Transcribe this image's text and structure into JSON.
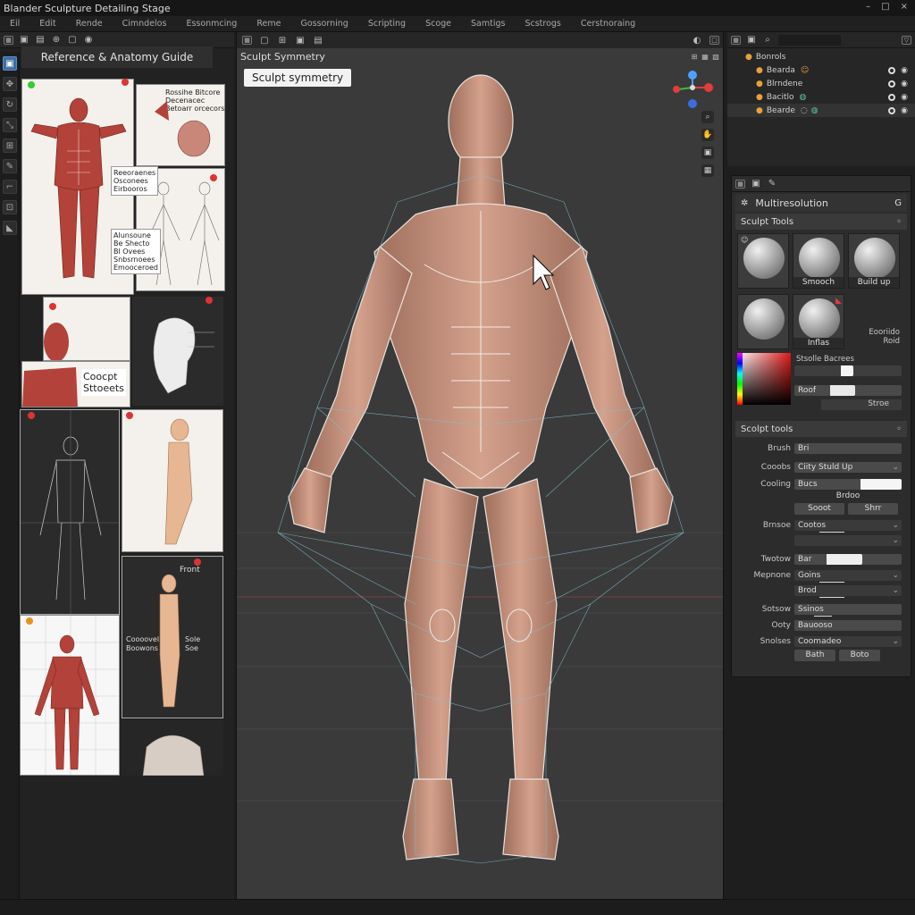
{
  "title": "Blander Sculpture Detailing Stage",
  "window_controls": [
    "–",
    "□",
    "×"
  ],
  "menu": [
    "Eil",
    "Edit",
    "Rende",
    "Cimndelos",
    "Essonmcing",
    "Reme",
    "Gossorning",
    "Scripting",
    "Scoge",
    "Samtigs",
    "Scstrogs",
    "Cerstnoraing"
  ],
  "left_panel": {
    "header": "Reference & Anatomy Guide",
    "notes": {
      "top_right": "Rossihe Bitcore\nDecenacec\nBetoarr orcecors",
      "mid_note": "Reeoraenes\nOsconees\nEirbooros",
      "left_note": "Alunsoune\nBe Shecto\nBl Ovees\nSnbsrnoees\nEmooceroed",
      "concept": "Coocpt\nSttoeets",
      "front": "Front",
      "side_labels": [
        "Coooovel",
        "Sole",
        "Boowons",
        "Soe"
      ]
    },
    "tools": [
      "cube",
      "move",
      "rotate",
      "scale",
      "transform",
      "annotate",
      "measure",
      "add",
      "ruler"
    ]
  },
  "viewport": {
    "header_icons": [
      "view-icon",
      "select-icon",
      "add-icon",
      "object-icon",
      "overlay-icon",
      "shading-icon"
    ],
    "subtitle": "Sculpt Symmetry",
    "badge": "Sculpt symmetry",
    "nav": [
      "zoom",
      "pan",
      "camera",
      "persp"
    ]
  },
  "outliner": {
    "rows": [
      {
        "label": "Bonrols",
        "indent": 0
      },
      {
        "label": "Bearda",
        "indent": 1
      },
      {
        "label": "Blrndene",
        "indent": 1
      },
      {
        "label": "Bacitlo",
        "indent": 1
      },
      {
        "label": "Bearde",
        "indent": 1
      }
    ]
  },
  "properties": {
    "modifier": "Multiresolution",
    "sculpt_tools_header": "Sculpt Tools",
    "tiles": [
      {
        "label": ""
      },
      {
        "label": "Smooch"
      },
      {
        "label": "Build up"
      },
      {
        "label": ""
      },
      {
        "label": "Inflas"
      }
    ],
    "side_text": "Eooriido\nRoid",
    "stroke_header": "Stsolle Bacrees",
    "color_rows": [
      "Roof",
      "Stroe"
    ],
    "sculpt_header": "Scolpt tools",
    "fields": [
      {
        "label": "Brush",
        "value": "Bri"
      },
      {
        "label": "Cooobs",
        "value": "Ciity Stuld Up"
      },
      {
        "label": "Cooling",
        "value": "Bucs"
      },
      {
        "label": "",
        "value": "Brdoo"
      }
    ],
    "buttons": [
      "Sooot",
      "Shrr"
    ],
    "dropdowns": [
      {
        "label": "Brnsoe",
        "value": "Cootos"
      },
      {
        "label": "Twotow",
        "value": "Bar"
      },
      {
        "label": "Mepnone",
        "value": "Goins"
      },
      {
        "label": "",
        "value": "Brod"
      },
      {
        "label": "Sotsow",
        "value": "Ssinos"
      },
      {
        "label": "Ooty",
        "value": "Bauooso"
      },
      {
        "label": "Snolses",
        "value": "Coomadeo"
      }
    ],
    "bottom_buttons": [
      "Bath",
      "Boto"
    ]
  }
}
